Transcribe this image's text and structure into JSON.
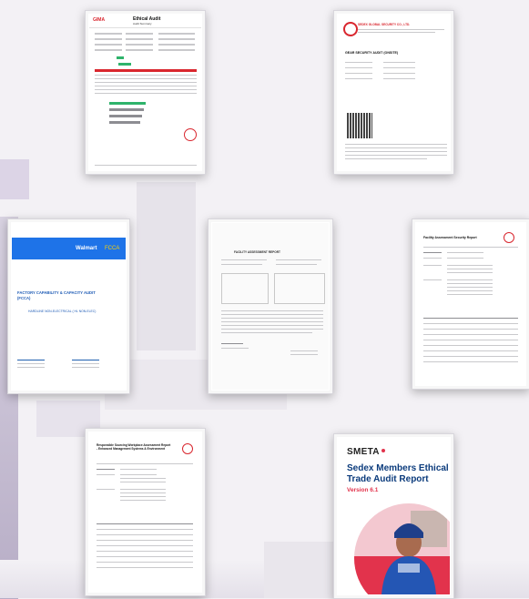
{
  "documents": [
    {
      "id": "ethical-audit",
      "brand": "GIMA",
      "title": "Ethical Audit",
      "subtitle": "Audit Summary",
      "colors": {
        "accent": "#d9262e",
        "bar": "#2fb36b"
      }
    },
    {
      "id": "sedex-security",
      "header": "SEDEX GLOBAL SECURITY CO., LTD.",
      "title": "GEAR SECURITY AUDIT (ONSITE)",
      "colors": {
        "accent": "#d9262e"
      }
    },
    {
      "id": "fcca",
      "brand": "Walmart",
      "brand_tag": "FCCA",
      "title_line1": "FACTORY CAPABILITY & CAPACITY AUDIT",
      "title_line2": "(FCCA)",
      "category": "HARDLINE NON-ELECTRICAL ( HL NON-ELEC)",
      "colors": {
        "header": "#1e73e8",
        "title": "#1e5bb5"
      }
    },
    {
      "id": "inspection-certificate",
      "title": "FACILITY ASSESSMENT REPORT"
    },
    {
      "id": "facility-security",
      "title": "Facility Assessment Security Report"
    },
    {
      "id": "responsible-sourcing",
      "title": "Responsible Sourcing Workplace Assessment Report - Enhanced Management Systems & Environment"
    },
    {
      "id": "smeta",
      "logo": "SMETA",
      "title_line1": "Sedex Members Ethical",
      "title_line2": "Trade Audit Report",
      "version": "Version 6.1",
      "colors": {
        "title": "#0b3b7c",
        "version": "#e2334c",
        "logo_dot": "#e2334c"
      }
    }
  ]
}
